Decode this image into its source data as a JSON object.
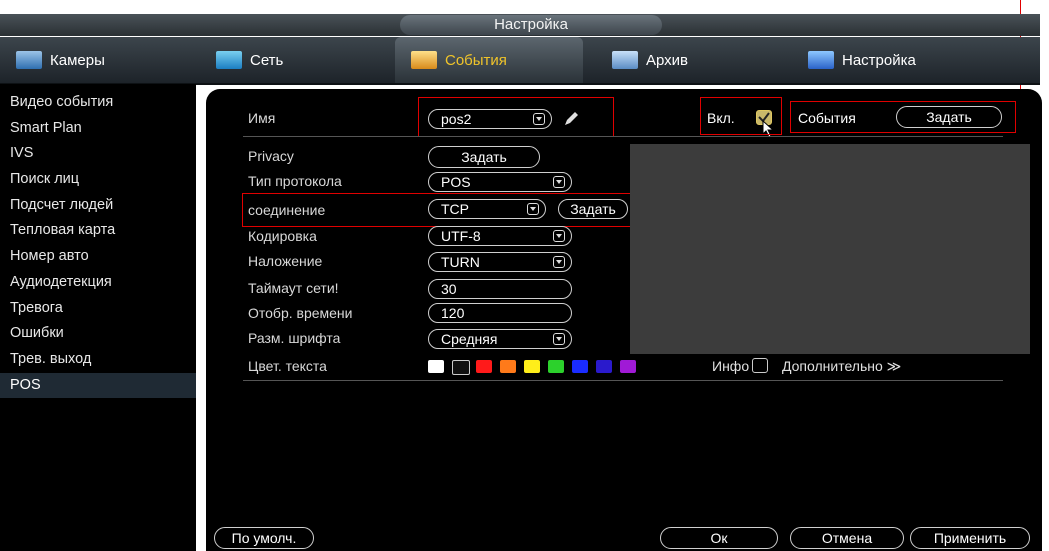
{
  "window": {
    "title": "Настройка"
  },
  "tabs": [
    {
      "label": "Камеры",
      "icon": "camera-icon"
    },
    {
      "label": "Сеть",
      "icon": "network-icon"
    },
    {
      "label": "События",
      "icon": "events-icon",
      "active": true
    },
    {
      "label": "Архив",
      "icon": "archive-icon"
    },
    {
      "label": "Настройка",
      "icon": "settings-icon"
    }
  ],
  "sidebar": {
    "items": [
      {
        "label": "Видео события"
      },
      {
        "label": "Smart Plan"
      },
      {
        "label": "IVS"
      },
      {
        "label": "Поиск лиц"
      },
      {
        "label": "Подсчет людей"
      },
      {
        "label": "Тепловая карта"
      },
      {
        "label": "Номер авто"
      },
      {
        "label": "Аудиодетекция"
      },
      {
        "label": "Тревога"
      },
      {
        "label": "Ошибки"
      },
      {
        "label": "Трев. выход"
      },
      {
        "label": "POS",
        "active": true
      }
    ]
  },
  "form": {
    "name_label": "Имя",
    "name_value": "pos2",
    "enable_label": "Вкл.",
    "enable_checked": true,
    "events_label": "События",
    "events_button": "Задать",
    "privacy_label": "Privacy",
    "privacy_button": "Задать",
    "protocol_label": "Тип протокола",
    "protocol_value": "POS",
    "connection_label": "соединение",
    "connection_value": "TCP",
    "connection_button": "Задать",
    "encoding_label": "Кодировка",
    "encoding_value": "UTF-8",
    "overlay_label": "Наложение",
    "overlay_value": "TURN",
    "timeout_label": "Таймаут сети!",
    "timeout_value": "30",
    "display_time_label": "Отобр. времени",
    "display_time_value": "120",
    "font_size_label": "Разм. шрифта",
    "font_size_value": "Средняя",
    "text_color_label": "Цвет. текста",
    "info_label": "Инфо",
    "more_label": "Дополнительно ≫",
    "colors": [
      "#ffffff",
      "#111111",
      "#ff1a1a",
      "#ff7a1a",
      "#ffee1a",
      "#2cd12c",
      "#1a2cff",
      "#2a1acc",
      "#a01ad6"
    ]
  },
  "footer": {
    "default_button": "По умолч.",
    "ok_button": "Ок",
    "cancel_button": "Отмена",
    "apply_button": "Применить"
  },
  "theme": {
    "active_tab_text": "#f0c42a",
    "annotation_red": "#e00000",
    "preview_bg": "#3c3c3c"
  }
}
